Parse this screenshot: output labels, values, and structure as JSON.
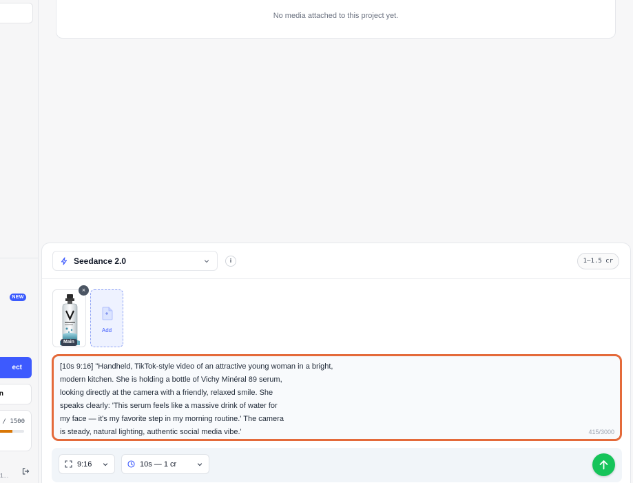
{
  "sidebar": {
    "new_badge": "NEW",
    "primary_button": "ect",
    "secondary_button": "n",
    "credits_text": "/ 1500",
    "credits_fraction": 0.62,
    "bottom_text": "1…"
  },
  "media": {
    "empty_text": "No media attached to this project yet."
  },
  "composer": {
    "model_name": "Seedance 2.0",
    "info_label": "i",
    "cost_badge": "1–1.5 cr",
    "attachments": [
      {
        "label": "Main",
        "remove_label": "×"
      }
    ],
    "add_label": "Add",
    "prompt": "[10s 9:16] \"Handheld, TikTok-style video of an attractive young woman in a bright,\nmodern kitchen. She is holding a bottle of Vichy Minéral 89 serum,\nlooking directly at the camera with a friendly, relaxed smile. She\nspeaks clearly: 'This serum feels like a massive drink of water for\nmy face — it's my favorite step in my morning routine.' The camera\nis steady, natural lighting, authentic social media vibe.'",
    "char_count": "415/3000",
    "aspect_ratio": "9:16",
    "duration": "10s — 1 cr"
  },
  "colors": {
    "accent": "#3d5afe",
    "prompt_border": "#e46a3a",
    "send": "#16c45a",
    "credits_bar": "#d97706"
  },
  "icons": {
    "model": "bolt-icon",
    "aspect": "expand-icon",
    "duration": "clock-icon",
    "send": "arrow-up-icon",
    "logout": "logout-icon"
  }
}
